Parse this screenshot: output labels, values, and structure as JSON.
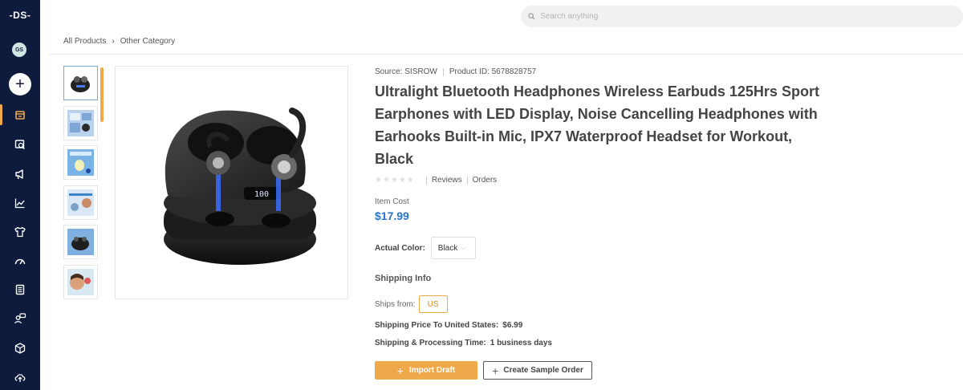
{
  "sidebar": {
    "logo": "-DS-",
    "avatar_initials": "GS",
    "add_label": "+",
    "items": [
      {
        "name": "store",
        "icon": "store-icon",
        "active": true
      },
      {
        "name": "product-search",
        "icon": "product-search-icon",
        "active": false
      },
      {
        "name": "marketing",
        "icon": "megaphone-icon",
        "active": false
      },
      {
        "name": "analytics",
        "icon": "chart-icon",
        "active": false
      },
      {
        "name": "apparel",
        "icon": "tshirt-icon",
        "active": false
      },
      {
        "name": "dashboard",
        "icon": "gauge-icon",
        "active": false
      },
      {
        "name": "orders",
        "icon": "document-icon",
        "active": false
      },
      {
        "name": "support",
        "icon": "user-chat-icon",
        "active": false
      },
      {
        "name": "inventory",
        "icon": "box-icon",
        "active": false
      },
      {
        "name": "upload",
        "icon": "cloud-upload-icon",
        "active": false
      }
    ],
    "accent": "#f0a94a",
    "background": "#0f1b3d"
  },
  "search": {
    "placeholder": "Search anything"
  },
  "breadcrumb": {
    "items": [
      "All Products",
      "Other Category"
    ]
  },
  "product": {
    "source_label": "Source: SISROW",
    "product_id_label": "Product ID: 5678828757",
    "title": "Ultralight Bluetooth Headphones Wireless Earbuds 125Hrs Sport Earphones with LED Display, Noise Cancelling Headphones with Earhooks Built-in Mic, IPX7 Waterproof Headset for Workout, Black",
    "stars": "★★★★★",
    "rating_value": 0,
    "reviews_label": "Reviews",
    "orders_label": "Orders",
    "item_cost_label": "Item Cost",
    "item_cost": "$17.99",
    "price_color": "#2774c8",
    "color_label": "Actual Color:",
    "color_value": "Black"
  },
  "shipping": {
    "heading": "Shipping Info",
    "ships_from_label": "Ships from:",
    "ships_from_value": "US",
    "price_label": "Shipping Price To United States:",
    "price_value": "$6.99",
    "time_label": "Shipping & Processing Time:",
    "time_value": "1 business days"
  },
  "actions": {
    "import_label": "Import Draft",
    "sample_label": "Create Sample Order"
  },
  "thumbnails": [
    {
      "name": "thumb-earbuds-case",
      "selected": true
    },
    {
      "name": "thumb-features",
      "selected": false
    },
    {
      "name": "thumb-charging",
      "selected": false
    },
    {
      "name": "thumb-sport-use",
      "selected": false
    },
    {
      "name": "thumb-case-closeup",
      "selected": false
    },
    {
      "name": "thumb-wearing",
      "selected": false
    }
  ]
}
